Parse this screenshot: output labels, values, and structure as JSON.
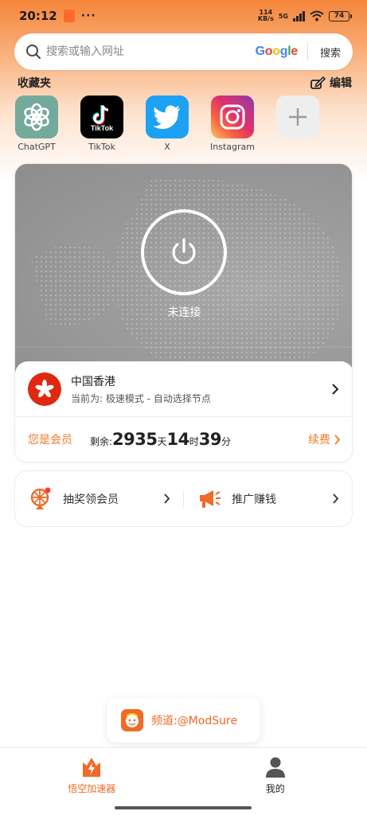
{
  "status_bar": {
    "time": "20:12",
    "dots": "···",
    "net_speed_value": "114",
    "net_speed_unit": "KB/s",
    "network_type": "5G",
    "battery": "74"
  },
  "search": {
    "placeholder": "搜索或输入网址",
    "engine": "Google",
    "button_label": "搜索"
  },
  "favorites": {
    "title": "收藏夹",
    "edit_label": "编辑",
    "items": [
      {
        "label": "ChatGPT",
        "icon": "chatgpt-icon",
        "color": "#74aa9c"
      },
      {
        "label": "TikTok",
        "icon": "tiktok-icon",
        "color": "#000000"
      },
      {
        "label": "X",
        "icon": "twitter-bird-icon",
        "color": "#1da1f2"
      },
      {
        "label": "Instagram",
        "icon": "instagram-icon",
        "color": "#e1306c"
      }
    ],
    "add_icon": "plus-icon"
  },
  "vpn": {
    "connection_status": "未连接",
    "server_name": "中国香港",
    "server_mode": "当前为: 极速模式 - 自动选择节点",
    "member_label": "您是会员",
    "remain_prefix": "剩余:",
    "remain_days": "2935",
    "days_unit": "天",
    "remain_hours": "14",
    "hours_unit": "时",
    "remain_minutes": "39",
    "minutes_unit": "分",
    "renew_label": "续费"
  },
  "promo": {
    "lottery_label": "抽奖领会员",
    "referral_label": "推广赚钱"
  },
  "toast": {
    "text": "频道:@ModSure"
  },
  "bottom_nav": {
    "tabs": [
      {
        "label": "悟空加速器",
        "icon": "rocket-flame-icon",
        "active": true
      },
      {
        "label": "我的",
        "icon": "person-icon",
        "active": false
      }
    ]
  },
  "colors": {
    "accent": "#f06a28",
    "member_orange": "#f07a25"
  }
}
